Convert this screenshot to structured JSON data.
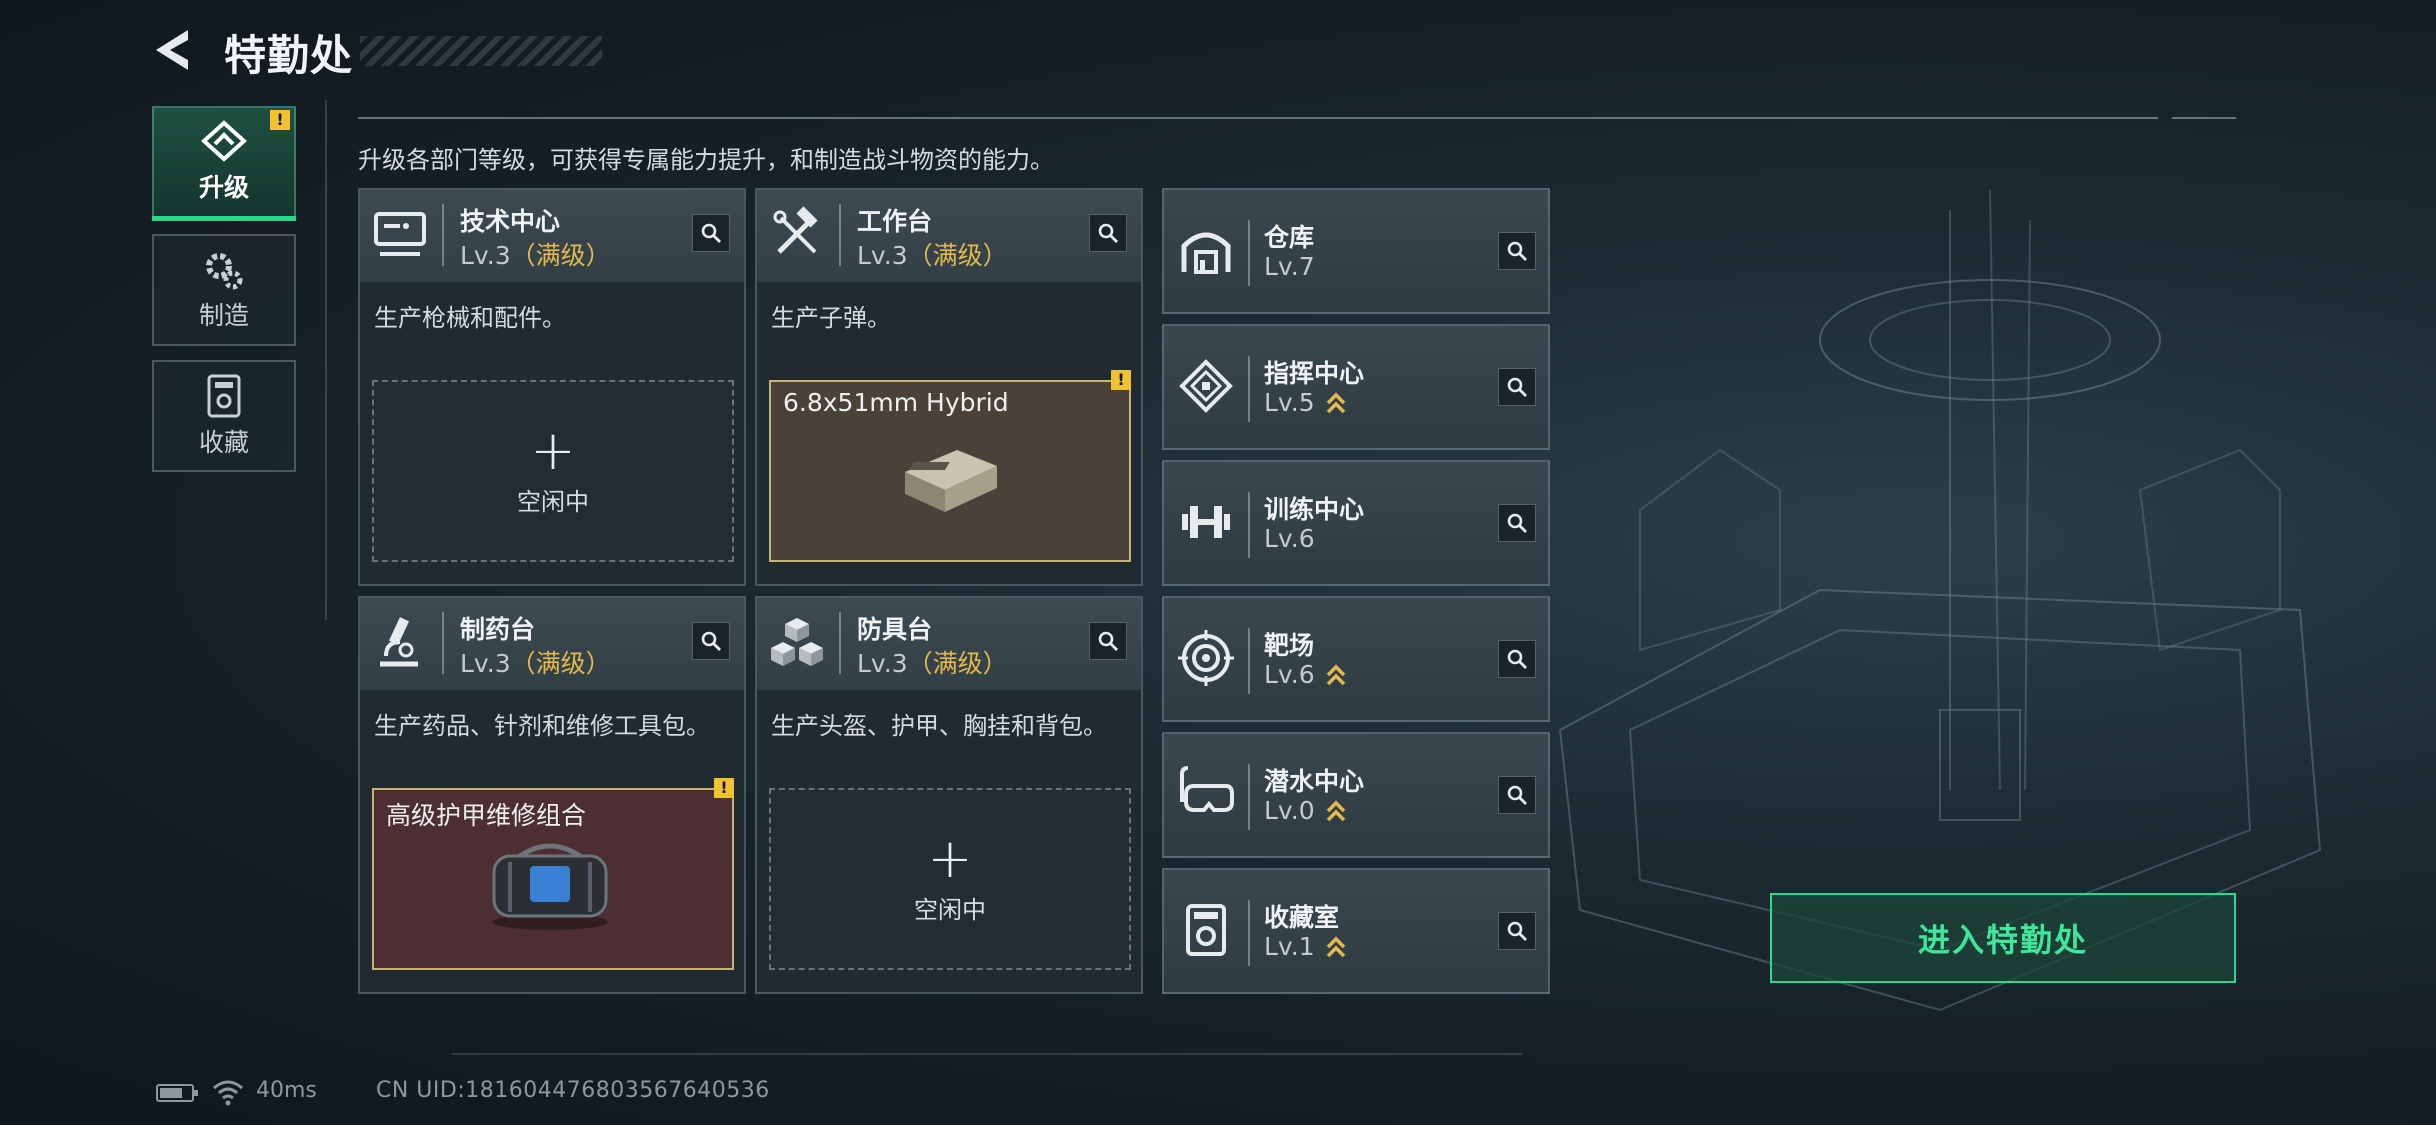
{
  "header": {
    "title": "特勤处"
  },
  "subtitle": "升级各部门等级，可获得专属能力提升，和制造战斗物资的能力。",
  "nav": [
    {
      "label": "升级",
      "icon": "upgrade-icon",
      "active": true,
      "badge": "!"
    },
    {
      "label": "制造",
      "icon": "gears-icon",
      "active": false
    },
    {
      "label": "收藏",
      "icon": "collection-icon",
      "active": false
    }
  ],
  "cards": [
    {
      "name": "技术中心",
      "level": "Lv.3",
      "max": "（满级）",
      "icon": "monitor-icon",
      "desc": "生产枪械和配件。",
      "slot": {
        "state": "idle",
        "plus": "+",
        "status": "空闲中"
      }
    },
    {
      "name": "工作台",
      "level": "Lv.3",
      "max": "（满级）",
      "icon": "tools-icon",
      "desc": "生产子弹。",
      "slot": {
        "state": "producing",
        "item": "6.8x51mm Hybrid",
        "badge": "!"
      }
    },
    {
      "name": "制药台",
      "level": "Lv.3",
      "max": "（满级）",
      "icon": "microscope-icon",
      "desc": "生产药品、针剂和维修工具包。",
      "slot": {
        "state": "producing",
        "item": "高级护甲维修组合",
        "badge": "!"
      }
    },
    {
      "name": "防具台",
      "level": "Lv.3",
      "max": "（满级）",
      "icon": "armor-cubes-icon",
      "desc": "生产头盔、护甲、胸挂和背包。",
      "slot": {
        "state": "idle",
        "plus": "+",
        "status": "空闲中"
      }
    }
  ],
  "rows": [
    {
      "name": "仓库",
      "level": "Lv.7",
      "upgradable": false,
      "icon": "warehouse-icon"
    },
    {
      "name": "指挥中心",
      "level": "Lv.5",
      "upgradable": true,
      "icon": "command-icon"
    },
    {
      "name": "训练中心",
      "level": "Lv.6",
      "upgradable": false,
      "icon": "dumbbell-icon"
    },
    {
      "name": "靶场",
      "level": "Lv.6",
      "upgradable": true,
      "icon": "target-icon"
    },
    {
      "name": "潜水中心",
      "level": "Lv.0",
      "upgradable": true,
      "icon": "diving-mask-icon"
    },
    {
      "name": "收藏室",
      "level": "Lv.1",
      "upgradable": true,
      "icon": "collection-room-icon"
    }
  ],
  "enter_button": "进入特勤处",
  "footer": {
    "ping": "40ms",
    "uid": "CN UID:18160447680356​7640536"
  },
  "colors": {
    "accent": "#2fd891",
    "max_level": "#e3b94b",
    "upgrade_chevron": "#e3b94b",
    "warning": "#f1c232"
  }
}
